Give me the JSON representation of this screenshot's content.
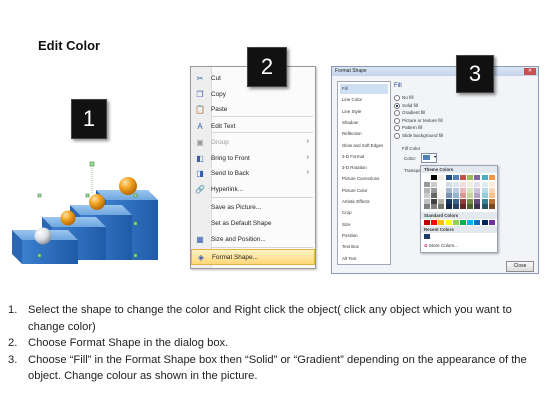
{
  "title": "Edit Color",
  "badges": [
    "1",
    "2",
    "3"
  ],
  "context_menu": {
    "items": [
      {
        "label": "Cut",
        "icon": "scissors-icon",
        "glyph": "✂",
        "state": "normal",
        "submenu": false
      },
      {
        "label": "Copy",
        "icon": "copy-icon",
        "glyph": "❐",
        "state": "normal",
        "submenu": false
      },
      {
        "label": "Paste",
        "icon": "paste-icon",
        "glyph": "📋",
        "state": "normal",
        "submenu": false
      },
      {
        "label": "Edit Text",
        "icon": "edit-text-icon",
        "glyph": "A",
        "state": "normal",
        "submenu": false
      },
      {
        "label": "Group",
        "icon": "group-icon",
        "glyph": "▣",
        "state": "disabled",
        "submenu": true
      },
      {
        "label": "Bring to Front",
        "icon": "bring-front-icon",
        "glyph": "◧",
        "state": "normal",
        "submenu": true
      },
      {
        "label": "Send to Back",
        "icon": "send-back-icon",
        "glyph": "◨",
        "state": "normal",
        "submenu": true
      },
      {
        "label": "Hyperlink...",
        "icon": "hyperlink-icon",
        "glyph": "🔗",
        "state": "normal",
        "submenu": false
      },
      {
        "label": "Save as Picture...",
        "icon": "",
        "glyph": "",
        "state": "normal",
        "submenu": false
      },
      {
        "label": "Set as Default Shape",
        "icon": "",
        "glyph": "",
        "state": "normal",
        "submenu": false
      },
      {
        "label": "Size and Position...",
        "icon": "size-position-icon",
        "glyph": "▦",
        "state": "normal",
        "submenu": false
      },
      {
        "label": "Format Shape...",
        "icon": "format-shape-icon",
        "glyph": "◈",
        "state": "highlighted",
        "submenu": false
      }
    ]
  },
  "dialog": {
    "title": "Format Shape",
    "close_glyph": "✕",
    "categories": [
      "Fill",
      "Line Color",
      "Line Style",
      "Shadow",
      "Reflection",
      "Glow and Soft Edges",
      "3-D Format",
      "3-D Rotation",
      "Picture Corrections",
      "Picture Color",
      "Artistic Effects",
      "Crop",
      "Size",
      "Position",
      "Text Box",
      "Alt Text"
    ],
    "selected_category": "Fill",
    "pane_heading": "Fill",
    "fill_options": [
      "No fill",
      "Solid fill",
      "Gradient fill",
      "Picture or texture fill",
      "Pattern fill",
      "Slide background fill"
    ],
    "selected_fill": "Solid fill",
    "fill_color_label": "Fill Color",
    "color_label": "Color:",
    "transparency_label": "Transpa",
    "theme_colors_label": "Theme Colors",
    "standard_colors_label": "Standard Colors",
    "recent_colors_label": "Recent Colors",
    "more_colors_label": "More Colors...",
    "close_button": "Close",
    "theme_top_row": [
      "#ffffff",
      "#000000",
      "#eeece1",
      "#1f497d",
      "#4f81bd",
      "#c0504d",
      "#9bbb59",
      "#8064a2",
      "#4bacc6",
      "#f79646"
    ],
    "standard_colors": [
      "#c00000",
      "#ff0000",
      "#ffc000",
      "#ffff00",
      "#92d050",
      "#00b050",
      "#00b0f0",
      "#0070c0",
      "#002060",
      "#7030a0"
    ],
    "recent_colors": [
      "#1f3864"
    ]
  },
  "instructions": [
    {
      "num": "1.",
      "text": "Select the shape to change the color and Right click the object( click any object which you want to change color)"
    },
    {
      "num": "2.",
      "text": "Choose Format Shape in the dialog box."
    },
    {
      "num": "3.",
      "text": "Choose “Fill” in the Format Shape box then “Solid” or “Gradient” depending on the appearance of the object. Change colour as shown in the picture."
    }
  ]
}
